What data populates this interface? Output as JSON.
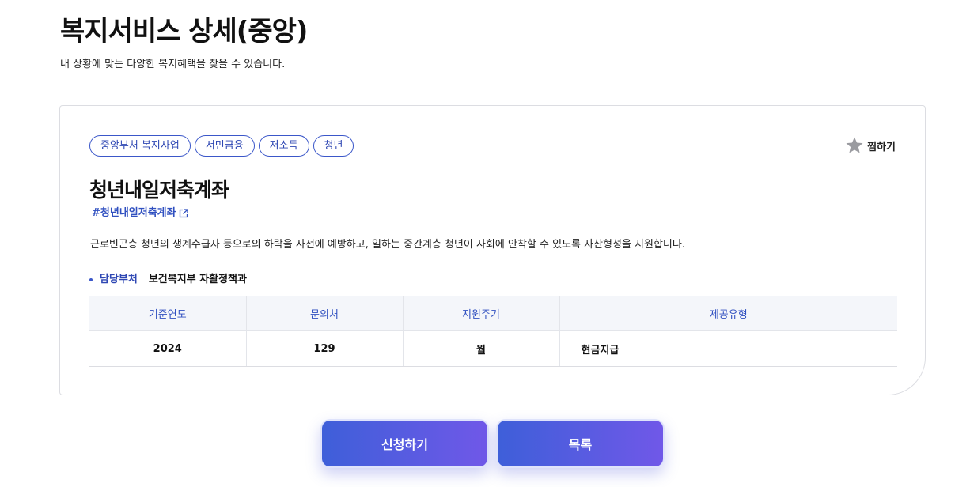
{
  "header": {
    "title": "복지서비스 상세(중앙)",
    "subtitle": "내 상황에 맞는 다양한 복지혜택을 찾을 수 있습니다."
  },
  "service": {
    "tags": [
      "중앙부처 복지사업",
      "서민금융",
      "저소득",
      "청년"
    ],
    "favorite_label": "찜하기",
    "title": "청년내일저축계좌",
    "hashtag": "#청년내일저축계좌",
    "description": "근로빈곤층 청년의 생계수급자 등으로의 하락을 사전에 예방하고, 일하는 중간계층 청년이 사회에 안착할 수 있도록 자산형성을 지원합니다.",
    "department_label": "담당부처",
    "department": "보건복지부 자활정책과"
  },
  "table": {
    "headers": [
      "기준연도",
      "문의처",
      "지원주기",
      "제공유형"
    ],
    "row": [
      "2024",
      "129",
      "월",
      "현금지급"
    ]
  },
  "buttons": {
    "apply": "신청하기",
    "list": "목록"
  },
  "colors": {
    "accent": "#2e47b3",
    "button_gradient_start": "#3e5fd9",
    "button_gradient_end": "#7058e8"
  },
  "icons": {
    "favorite": "star-icon",
    "external_link": "external-link-icon"
  }
}
